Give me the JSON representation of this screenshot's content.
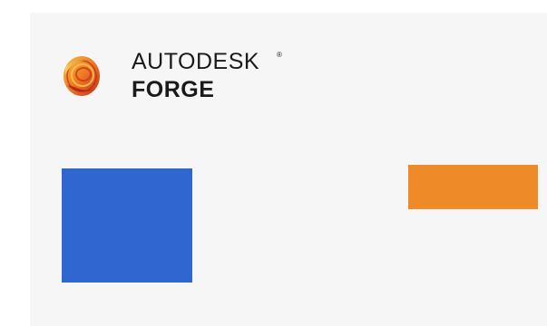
{
  "brand": {
    "company": "AUTODESK",
    "registered_mark": "®",
    "product": "FORGE",
    "logo_icon": "autodesk-forge-logo"
  },
  "colors": {
    "panel_background": "#f6f6f6",
    "blue_block": "#3066d0",
    "orange_block": "#ee8a27",
    "logo_dark": "#b7251b",
    "logo_mid": "#e1561f",
    "logo_light": "#f6b23a"
  }
}
